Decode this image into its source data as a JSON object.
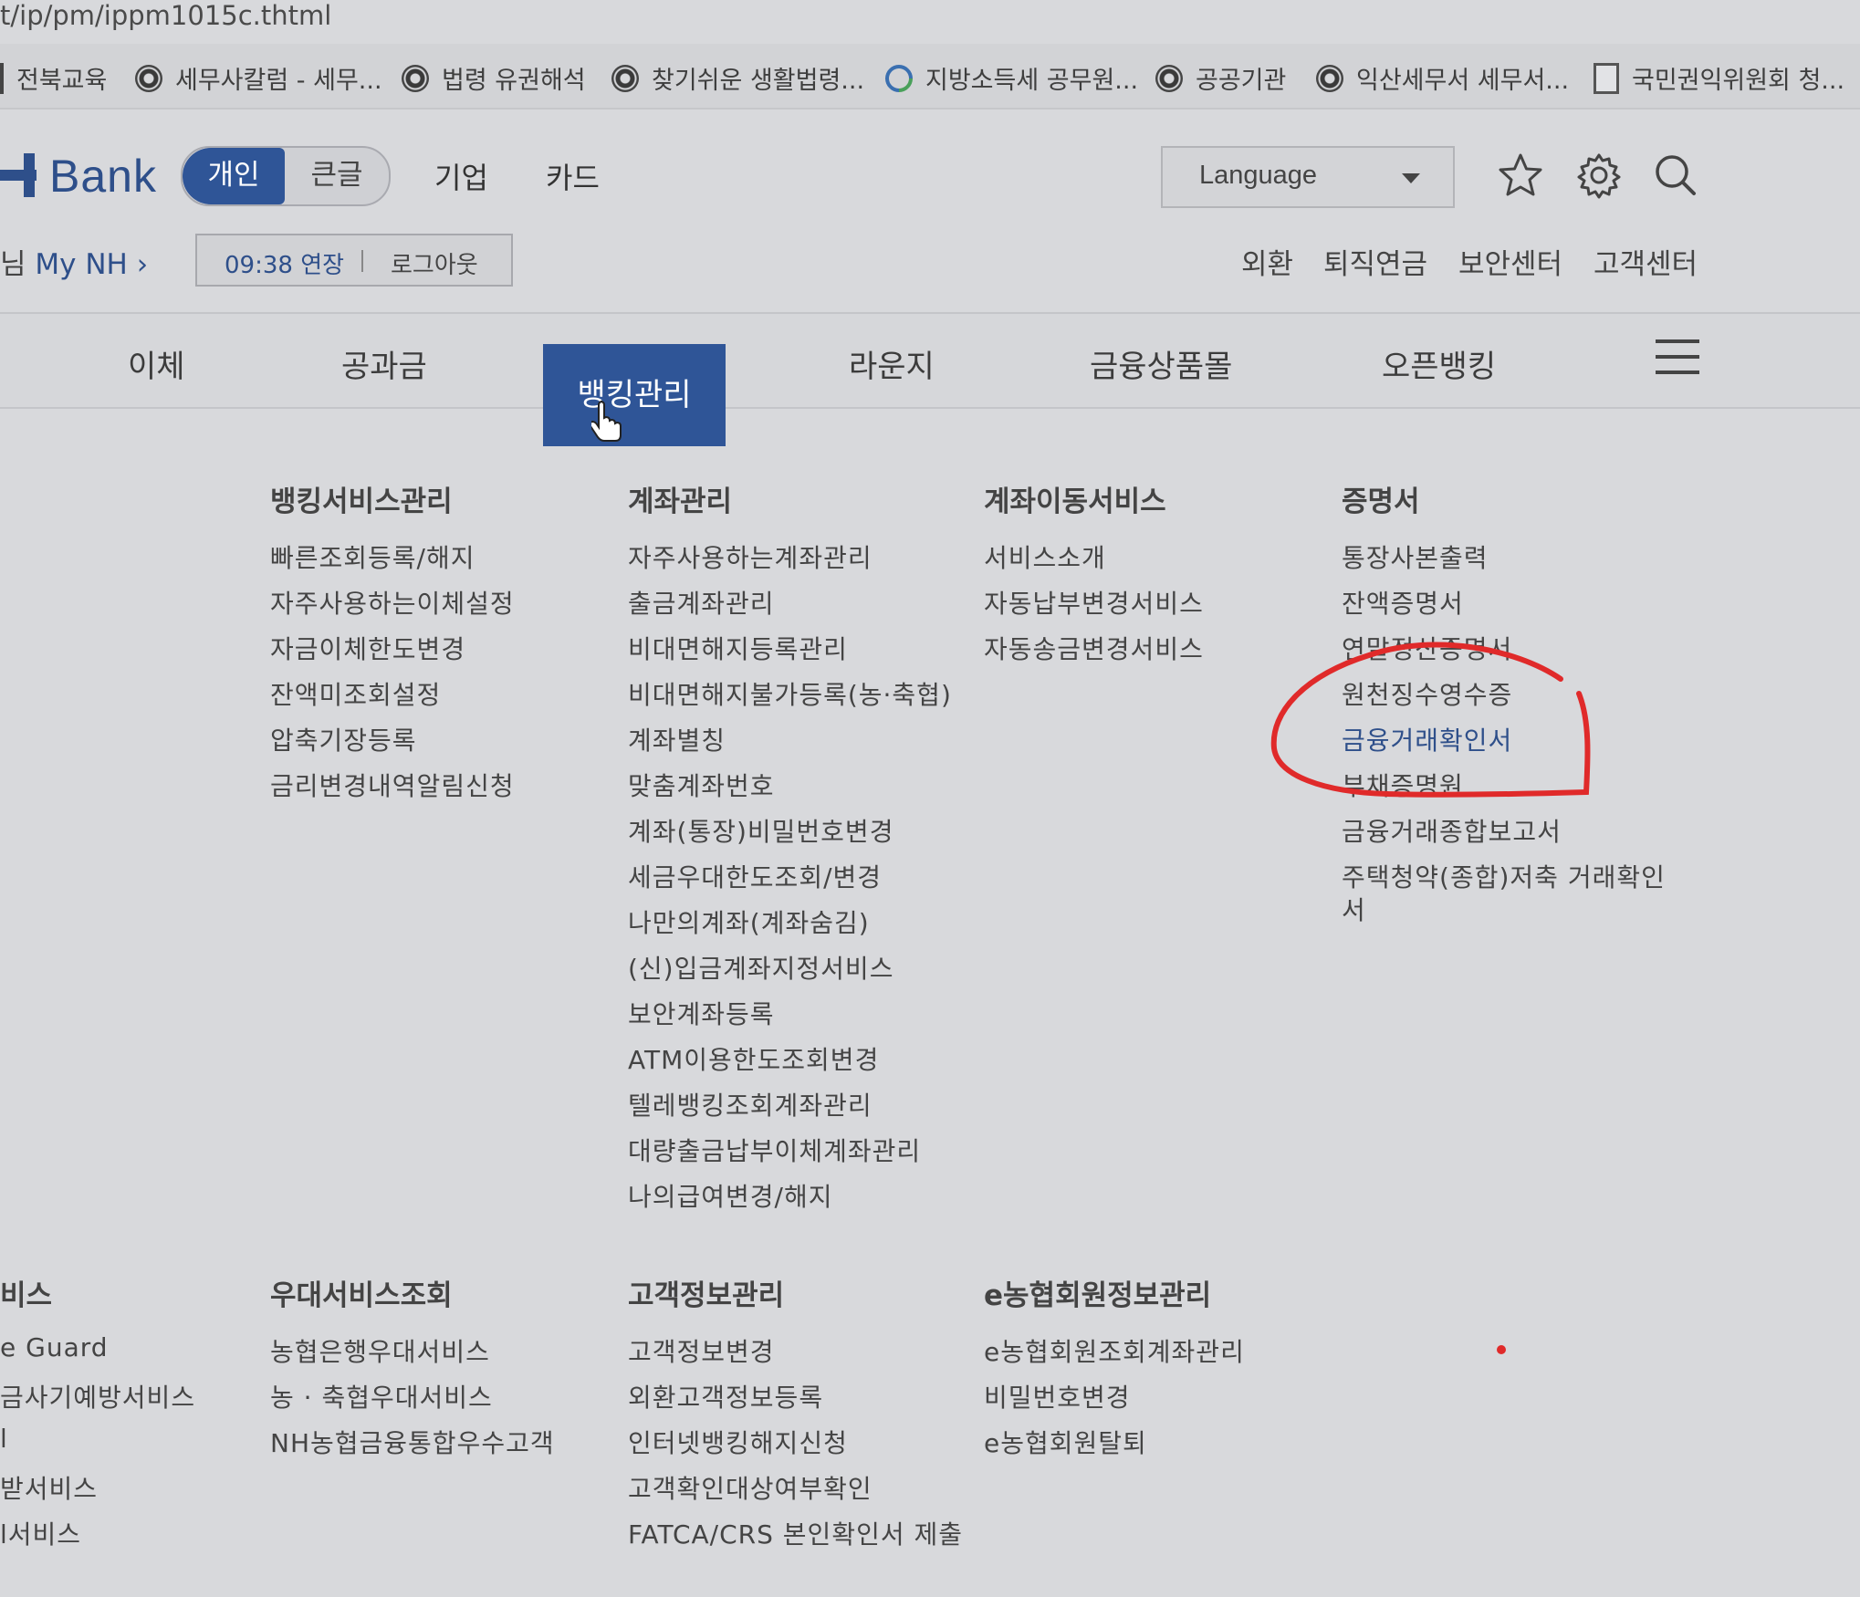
{
  "browser": {
    "url": "t/ip/pm/ippm1015c.thtml",
    "bookmarks": [
      {
        "label": "전북교육",
        "icon": "folder-edge-icon"
      },
      {
        "label": "세무사칼럼 - 세무...",
        "icon": "seal-icon"
      },
      {
        "label": "법령 유권해석",
        "icon": "seal-icon"
      },
      {
        "label": "찾기쉬운 생활법령...",
        "icon": "seal-icon"
      },
      {
        "label": "지방소득세 공무원...",
        "icon": "link-icon"
      },
      {
        "label": "공공기관",
        "icon": "seal-icon"
      },
      {
        "label": "익산세무서 세무서...",
        "icon": "seal-icon"
      },
      {
        "label": "국민권익위원회 청...",
        "icon": "document-icon"
      }
    ]
  },
  "header": {
    "logo_text": "Bank",
    "segment": {
      "personal": "개인",
      "large_text": "큰글"
    },
    "nav": [
      "기업",
      "카드"
    ],
    "language": "Language",
    "icons": [
      "star-icon",
      "gear-icon",
      "search-icon"
    ]
  },
  "account": {
    "prefix": "님",
    "my_nh": "My NH",
    "session_time": "09:38 연장",
    "logout": "로그아웃",
    "utilities": [
      "외환",
      "퇴직연금",
      "보안센터",
      "고객센터"
    ]
  },
  "mainnav": {
    "items": [
      "이체",
      "공과금",
      "뱅킹관리",
      "라운지",
      "금융상품몰",
      "오픈뱅킹"
    ],
    "active": "뱅킹관리"
  },
  "menu": {
    "banking_service": {
      "title": "뱅킹서비스관리",
      "items": [
        "빠른조회등록/해지",
        "자주사용하는이체설정",
        "자금이체한도변경",
        "잔액미조회설정",
        "압축기장등록",
        "금리변경내역알림신청"
      ]
    },
    "account_mgmt": {
      "title": "계좌관리",
      "items": [
        "자주사용하는계좌관리",
        "출금계좌관리",
        "비대면해지등록관리",
        "비대면해지불가등록(농·축협)",
        "계좌별칭",
        "맞춤계좌번호",
        "계좌(통장)비밀번호변경",
        "세금우대한도조회/변경",
        "나만의계좌(계좌숨김)",
        "(신)입금계좌지정서비스",
        "보안계좌등록",
        "ATM이용한도조회변경",
        "텔레뱅킹조회계좌관리",
        "대량출금납부이체계좌관리",
        "나의급여변경/해지"
      ]
    },
    "account_transfer": {
      "title": "계좌이동서비스",
      "items": [
        "서비스소개",
        "자동납부변경서비스",
        "자동송금변경서비스"
      ]
    },
    "certificates": {
      "title": "증명서",
      "items": [
        "통장사본출력",
        "잔액증명서",
        "연말정산증명서",
        "원천징수영수증",
        "금융거래확인서",
        "부채증명원",
        "금융거래종합보고서",
        "주택청약(종합)저축 거래확인",
        "서"
      ],
      "highlighted": "금융거래확인서"
    },
    "left_partial": {
      "title": "비스",
      "items": [
        "e Guard",
        "금사기예방서비스",
        "l",
        "받서비스",
        "l서비스"
      ]
    },
    "preferential": {
      "title": "우대서비스조회",
      "items": [
        "농협은행우대서비스",
        "농 · 축협우대서비스",
        "NH농협금융통합우수고객"
      ]
    },
    "customer_info": {
      "title": "고객정보관리",
      "items": [
        "고객정보변경",
        "외환고객정보등록",
        "인터넷뱅킹해지신청",
        "고객확인대상여부확인",
        "FATCA/CRS 본인확인서 제출"
      ]
    },
    "e_member": {
      "title": "e농협회원정보관리",
      "items": [
        "e농협회원조회계좌관리",
        "비밀번호변경",
        "e농협회원탈퇴"
      ]
    }
  },
  "colors": {
    "brand": "#2f5597",
    "annotation": "#e02a2a"
  }
}
